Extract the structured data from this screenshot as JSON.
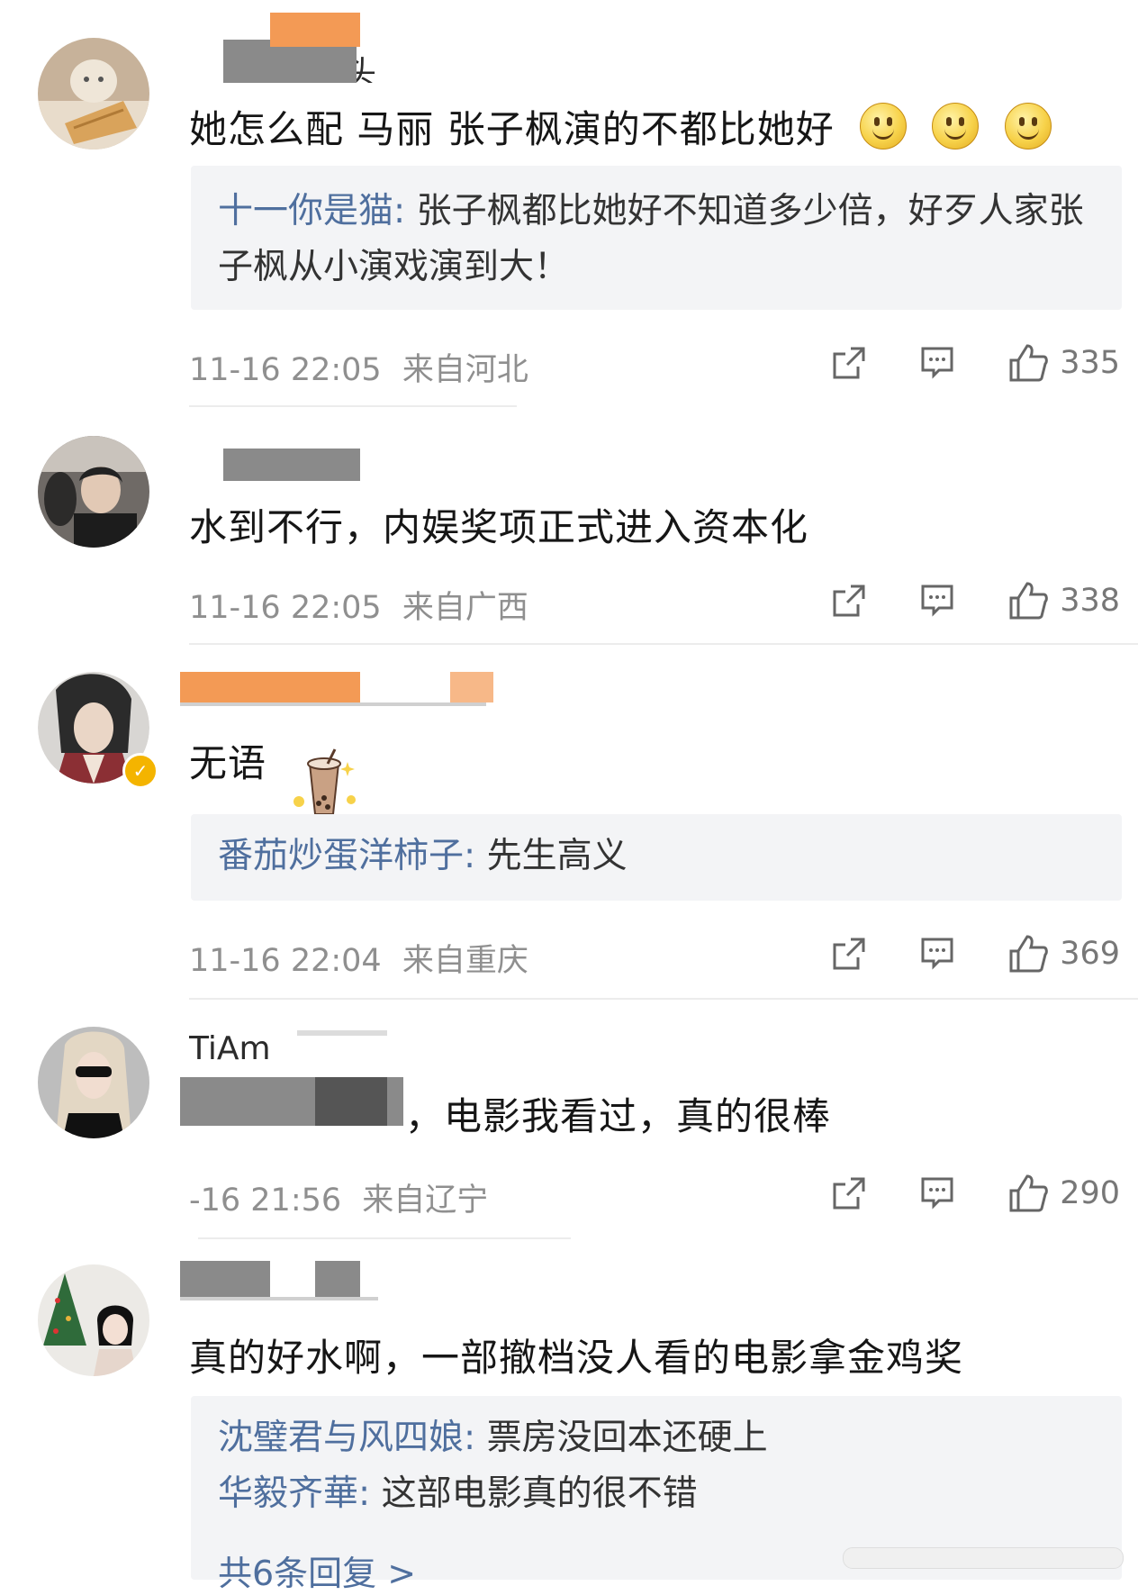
{
  "comments": [
    {
      "username": "心头",
      "text": "她怎么配 马丽 张子枫演的不都比她好",
      "replies": [
        {
          "name": "十一你是猫",
          "text": "张子枫都比她好不知道多少倍，好歹人家张子枫从小演戏演到大！"
        }
      ],
      "time": "11-16 22:05",
      "location": "来自河北",
      "likes": "335"
    },
    {
      "username": "",
      "text": "水到不行，内娱奖项正式进入资本化",
      "replies": [],
      "time": "11-16 22:05",
      "location": "来自广西",
      "likes": "338"
    },
    {
      "username": "",
      "text": "无语",
      "replies": [
        {
          "name": "番茄炒蛋洋柿子",
          "text": "先生高义"
        }
      ],
      "time": "11-16 22:04",
      "location": "来自重庆",
      "likes": "369"
    },
    {
      "username": "TiAm",
      "text": "，电影我看过，真的很棒",
      "replies": [],
      "time": "-16 21:56",
      "location": "来自辽宁",
      "likes": "290"
    },
    {
      "username": "",
      "text": "真的好水啊，一部撤档没人看的电影拿金鸡奖",
      "replies": [
        {
          "name": "沈璧君与风四娘",
          "text": "票房没回本还硬上"
        },
        {
          "name": "华毅齐華",
          "text": "这部电影真的很不错"
        }
      ],
      "more_replies": "共6条回复 >"
    }
  ],
  "icons": {
    "share": "share-icon",
    "comment": "comment-icon",
    "like": "like-icon",
    "emoji": "smile-emoji-icon",
    "sticker": "milk-tea-sticker-icon",
    "verified": "verified-badge-icon"
  },
  "colors": {
    "reply_name": "#4f6f9e",
    "meta": "#8f8f8f",
    "mask_orange": "#f39a55",
    "mask_gray": "#8a8a8a"
  }
}
